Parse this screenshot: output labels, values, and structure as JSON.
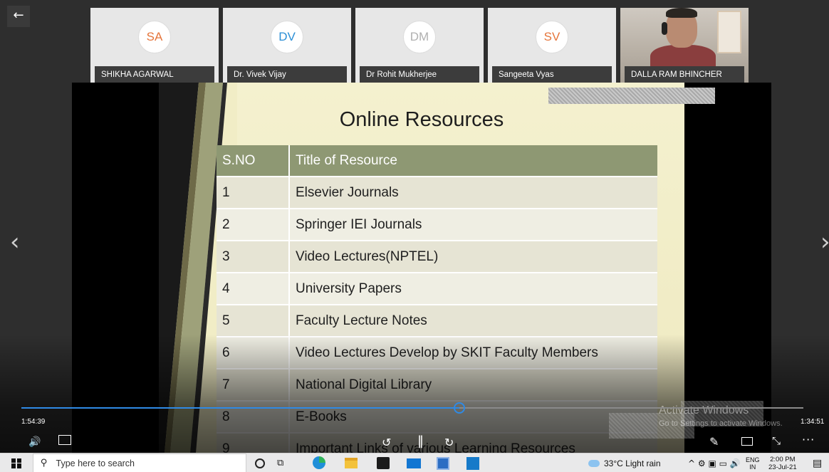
{
  "window": {
    "back_icon": "arrow-left-icon",
    "back_symbol": "←"
  },
  "participants": [
    {
      "initials": "SA",
      "name": "SHIKHA AGARWAL",
      "color": "#e5753b"
    },
    {
      "initials": "DV",
      "name": "Dr. Vivek Vijay",
      "color": "#2b8fd6"
    },
    {
      "initials": "DM",
      "name": "Dr Rohit Mukherjee",
      "color": "#b0b0b0"
    },
    {
      "initials": "SV",
      "name": "Sangeeta Vyas",
      "color": "#e5753b"
    },
    {
      "initials": "",
      "name": "DALLA RAM BHINCHER",
      "video": true
    }
  ],
  "slide": {
    "title": "Online Resources",
    "table": {
      "headers": [
        "S.NO",
        "Title of Resource"
      ],
      "rows": [
        [
          "1",
          "Elsevier Journals"
        ],
        [
          "2",
          "Springer IEI Journals"
        ],
        [
          "3",
          "Video Lectures(NPTEL)"
        ],
        [
          "4",
          "University Papers"
        ],
        [
          "5",
          "Faculty Lecture Notes"
        ],
        [
          "6",
          "Video Lectures Develop by SKIT Faculty Members"
        ],
        [
          "7",
          "National Digital Library"
        ],
        [
          "8",
          "E-Books"
        ],
        [
          "9",
          "Important Links of various Learning Resources"
        ]
      ]
    },
    "header_color": "#8e9873"
  },
  "nav": {
    "prev_symbol": "‹",
    "next_symbol": "›"
  },
  "player": {
    "elapsed": "1:54:39",
    "remaining": "1:34:51",
    "progress_fraction": 0.56,
    "accent": "#2f8ae5",
    "volume_symbol": "🔊",
    "rewind_symbol": "↺",
    "pause_symbol": "‖",
    "forward_symbol": "↻",
    "pen_symbol": "✎",
    "collapse_symbol": "⤡",
    "more_symbol": "···"
  },
  "watermark": {
    "title": "Activate Windows",
    "subtitle": "Go to Settings to activate Windows."
  },
  "taskbar": {
    "search_placeholder": "Type here to search",
    "search_symbol": "⚲",
    "taskview_symbol": "⧉",
    "weather": "33°C  Light rain",
    "tray_symbols": "^ ⚙ ▣ ▭ 🔊",
    "lang_top": "ENG",
    "lang_bottom": "IN",
    "time": "2:00 PM",
    "date": "23-Jul-21",
    "notif_symbol": "▤"
  }
}
